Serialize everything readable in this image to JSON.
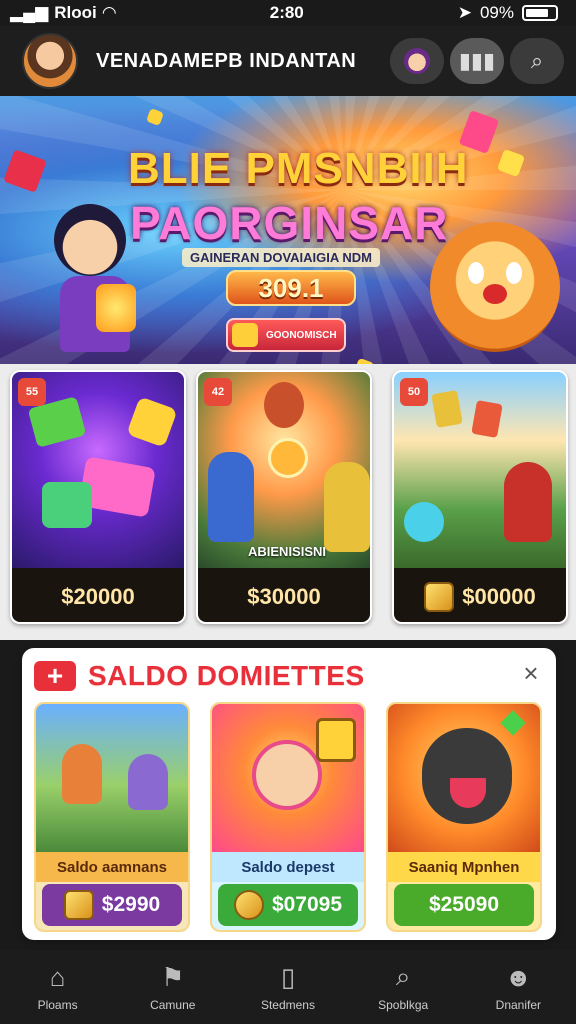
{
  "status": {
    "carrier": "Rlooi",
    "time": "2:80",
    "battery": "09%"
  },
  "header": {
    "title": "VENADAMEPB INDANTAN"
  },
  "hero": {
    "title_line1": "BLIE PMSNBIIH",
    "title_line2": "PAORGINSAR",
    "subtitle": "GAINERAN DOVAIAIGIA NDM",
    "amount": "309.1",
    "cta_label": "GOONOMISCH"
  },
  "cards": [
    {
      "tag": "55",
      "price": "$20000",
      "caption": ""
    },
    {
      "tag": "42",
      "price": "$30000",
      "caption": "ABIENISISNI"
    },
    {
      "tag": "50",
      "price": "$00000",
      "caption": ""
    }
  ],
  "promo": {
    "title": "SALDO DOMIETTES",
    "badge": "+",
    "close": "×",
    "offers": [
      {
        "name": "Saldo aamnans",
        "price": "$2990"
      },
      {
        "name": "Saldo depest",
        "price": "$07095"
      },
      {
        "name": "Saaniq Mpnhen",
        "price": "$25090"
      }
    ]
  },
  "nav": [
    {
      "label": "Ploams",
      "icon": "home-icon"
    },
    {
      "label": "Camune",
      "icon": "flag-icon"
    },
    {
      "label": "Stedmens",
      "icon": "card-icon"
    },
    {
      "label": "Spoblkga",
      "icon": "search-icon"
    },
    {
      "label": "Dnanifer",
      "icon": "profile-icon"
    }
  ],
  "colors": {
    "accent": "#e8303a",
    "nav_bg": "#1c1c1c",
    "header_bg": "#1e1e1e"
  }
}
